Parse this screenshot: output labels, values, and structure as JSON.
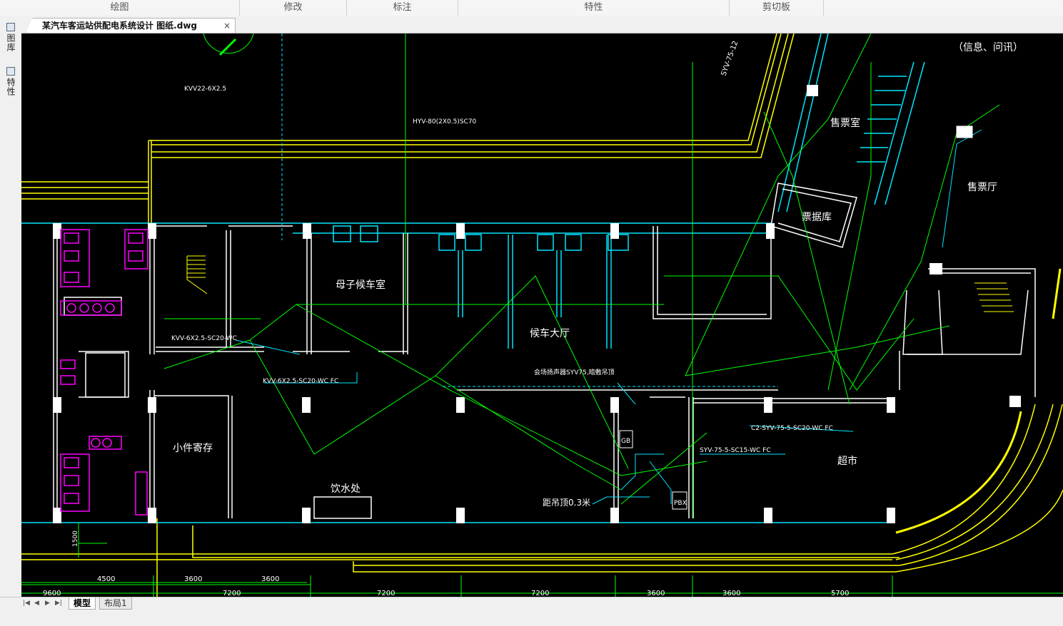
{
  "ribbon": {
    "groups": [
      "绘图",
      "修改",
      "标注",
      "特性",
      "剪切板"
    ]
  },
  "side_panel": {
    "tabs": [
      "图库",
      "特性"
    ]
  },
  "document": {
    "tab_title": "某汽车客运站供配电系统设计 图纸.dwg",
    "close_glyph": "×"
  },
  "drawing": {
    "rooms": {
      "mother_child": "母子候车室",
      "waiting_hall": "候车大厅",
      "ticket_room": "售票室",
      "ticket_hall": "售票厅",
      "ticket_store": "票据库",
      "luggage": "小件寄存",
      "drinking": "饮水处",
      "supermarket": "超市",
      "info": "（信息、问讯）"
    },
    "labels": {
      "cable_kvv22": "KVV22-6X2.5",
      "cable_hyv": "HYV-80(2X0.5)SC70",
      "cable_syv_top": "SYV-75-12",
      "cable_kvv_ws": "KVV-6X2.5-SC20-WC",
      "cable_kvv_fc": "KVV-6X2.5-SC20-WC FC",
      "cable_syv5": "SYV-75-5-SC15-WC FC",
      "cable_c2": "C2-SYV-75-5-SC20-WC FC",
      "broadcast": "会场扬声器SYV75,暗敷吊顶",
      "ceiling": "距吊顶0.3米",
      "gb": "GB",
      "pbx": "PBX",
      "dim_1500": "1500"
    },
    "dimensions": [
      "9600",
      "4500",
      "3600",
      "3600",
      "7200",
      "7200",
      "7200",
      "3600",
      "3600",
      "5700"
    ]
  },
  "layout_tabs": [
    "模型",
    "布局1"
  ],
  "nav_buttons": [
    "|◀",
    "◀",
    "▶",
    "▶|"
  ],
  "colors": {
    "wall": "#ffffff",
    "yellow": "#ffff00",
    "cyan": "#00e5ff",
    "green": "#00ff00",
    "magenta": "#ff00ff"
  }
}
